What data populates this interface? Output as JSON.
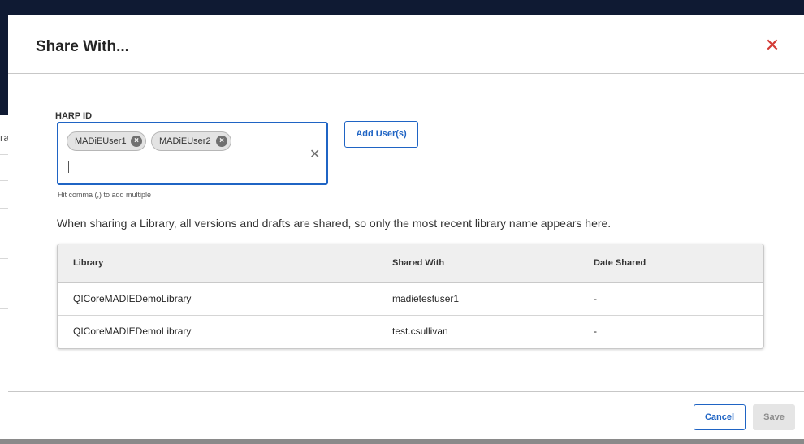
{
  "background": {
    "fragment": "ra"
  },
  "dialog": {
    "title": "Share With...",
    "close_icon": "close-icon",
    "field": {
      "label": "HARP ID",
      "chips": [
        {
          "label": "MADiEUser1"
        },
        {
          "label": "MADiEUser2"
        }
      ],
      "input_value": "",
      "helper_text": "Hit comma (,) to add multiple"
    },
    "add_button_label": "Add User(s)",
    "notice": "When sharing a Library, all versions and drafts are shared, so only the most recent library name appears here.",
    "table": {
      "headers": [
        "Library",
        "Shared With",
        "Date Shared"
      ],
      "rows": [
        [
          "QICoreMADIEDemoLibrary",
          "madietestuser1",
          "-"
        ],
        [
          "QICoreMADIEDemoLibrary",
          "test.csullivan",
          "-"
        ]
      ]
    },
    "footer": {
      "cancel_label": "Cancel",
      "save_label": "Save"
    }
  },
  "colors": {
    "accent": "#1f64c4",
    "close": "#d33a35"
  }
}
